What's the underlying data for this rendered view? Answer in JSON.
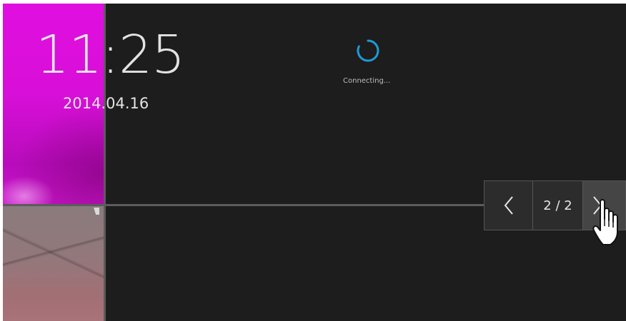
{
  "clock": {
    "time": "11:25",
    "date": "2014.04.16"
  },
  "status": {
    "text": "Connecting...",
    "spinner_color": "#1e9bd7"
  },
  "pager": {
    "page_indicator": "2 / 2"
  },
  "colors": {
    "background": "#1d1d1d",
    "divider": "#5c5c5c",
    "tile_magenta": "#d80fd8",
    "tile_rose": "#a26f74"
  },
  "icons": [
    "chevron-left-icon",
    "chevron-right-icon",
    "pointing-hand-cursor-icon",
    "loading-spinner-icon"
  ]
}
